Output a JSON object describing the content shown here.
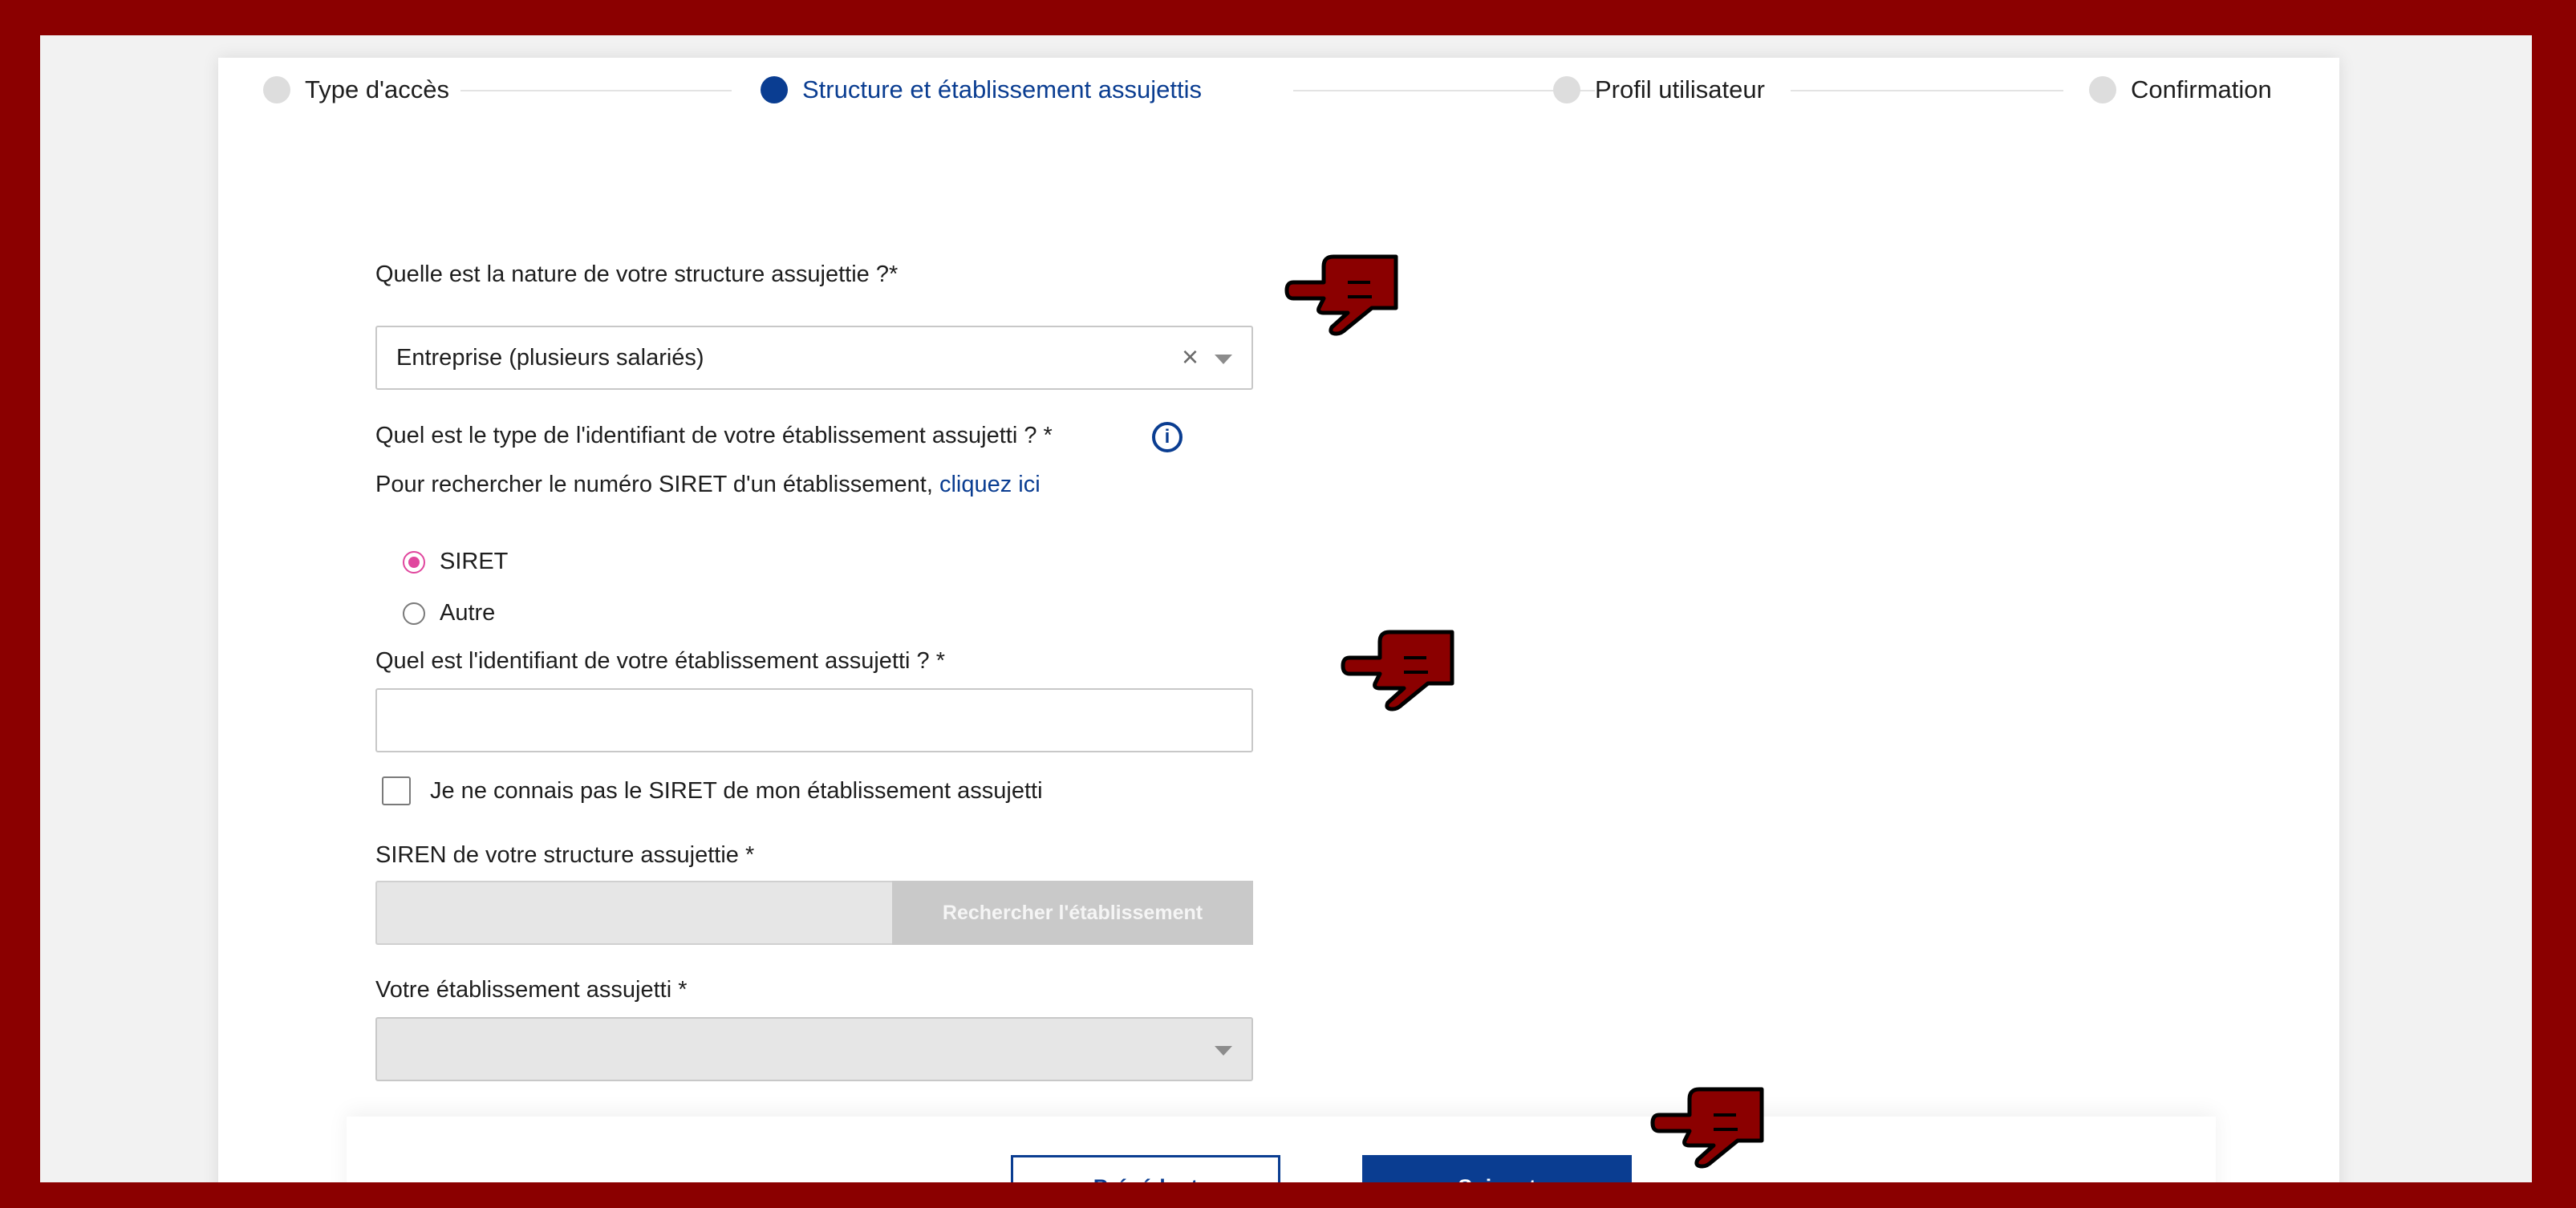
{
  "stepper": {
    "steps": [
      {
        "label": "Type d'accès",
        "state": "inactive"
      },
      {
        "label": "Structure et établissement assujettis",
        "state": "active"
      },
      {
        "label": "Profil utilisateur",
        "state": "inactive"
      },
      {
        "label": "Confirmation",
        "state": "inactive"
      }
    ]
  },
  "form": {
    "nature_question": "Quelle est la nature de votre structure assujettie ?*",
    "nature_value": "Entreprise (plusieurs salariés)",
    "id_type_question": "Quel est le type de l'identifiant de votre établissement assujetti ? *",
    "siret_help_prefix": "Pour rechercher le numéro SIRET d'un établissement, ",
    "siret_help_link": "cliquez ici",
    "id_type_options": [
      {
        "label": "SIRET",
        "checked": true
      },
      {
        "label": "Autre",
        "checked": false
      }
    ],
    "identifier_question": "Quel est l'identifiant de votre établissement assujetti ? *",
    "identifier_value": "",
    "unknown_siret_label": "Je ne connais pas le SIRET de mon établissement assujetti",
    "unknown_siret_checked": false,
    "siren_label": "SIREN de votre structure assujettie *",
    "siren_value": "",
    "search_button": "Rechercher l'établissement",
    "establishment_label": "Votre établissement assujetti *",
    "establishment_value": ""
  },
  "actions": {
    "previous": "Précédent",
    "next": "Suivant"
  },
  "colors": {
    "frame": "#8b0000",
    "primary": "#0a3d91",
    "radio_checked": "#e0479e",
    "hand_annotation": "#8b0000"
  }
}
